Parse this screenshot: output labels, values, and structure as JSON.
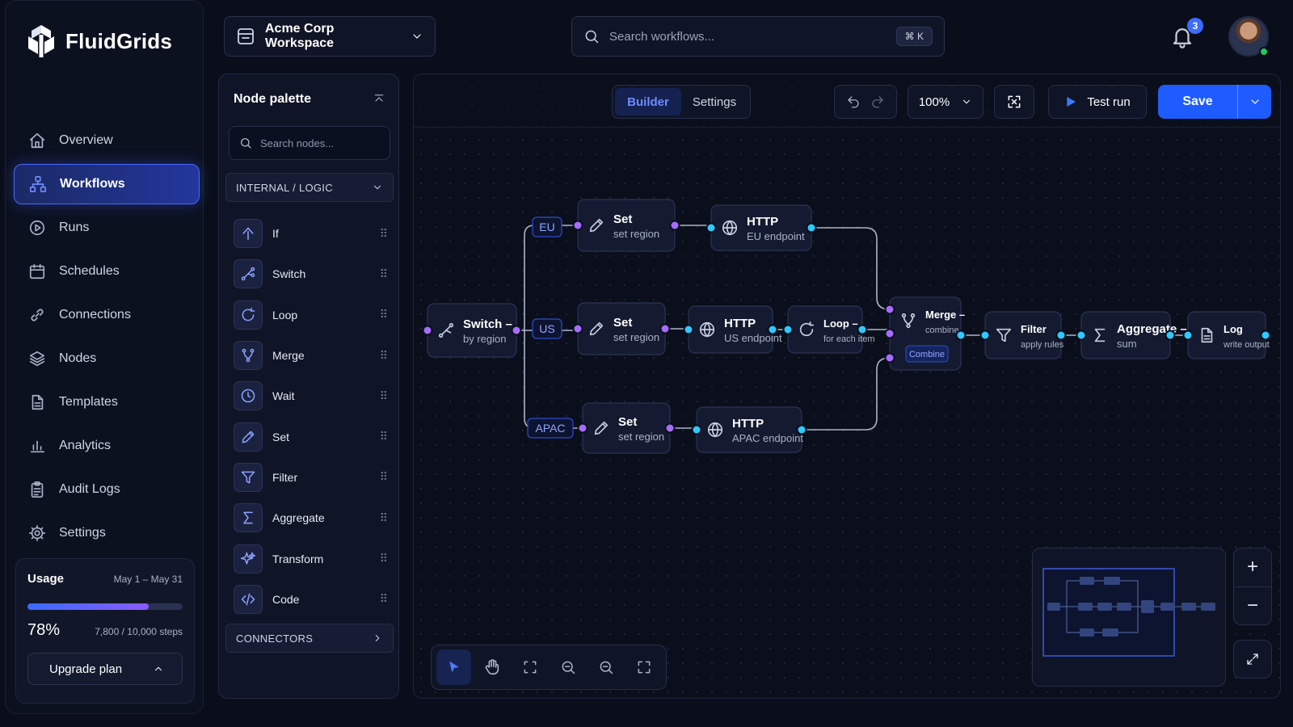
{
  "app": {
    "name": "FluidGrids"
  },
  "sidebar": {
    "items": [
      {
        "label": "Overview",
        "icon": "home-icon"
      },
      {
        "label": "Workflows",
        "icon": "workflow-icon",
        "active": true
      },
      {
        "label": "Runs",
        "icon": "play-circle-icon"
      },
      {
        "label": "Schedules",
        "icon": "calendar-icon"
      },
      {
        "label": "Connections",
        "icon": "link-icon"
      },
      {
        "label": "Nodes",
        "icon": "layers-icon"
      },
      {
        "label": "Templates",
        "icon": "document-icon"
      },
      {
        "label": "Analytics",
        "icon": "bar-chart-icon"
      },
      {
        "label": "Audit Logs",
        "icon": "clipboard-icon"
      },
      {
        "label": "Settings",
        "icon": "gear-icon"
      }
    ],
    "usage": {
      "title": "Usage",
      "range": "May 1 – May 31",
      "percent_label": "78%",
      "percent_value": 0.78,
      "steps": "7,800 / 10,000 steps",
      "upgrade_label": "Upgrade plan"
    }
  },
  "topbar": {
    "workspace": "Acme Corp Workspace",
    "search_placeholder": "Search workflows...",
    "search_shortcut": "⌘ K",
    "notifications": "3"
  },
  "palette": {
    "title": "Node palette",
    "search_placeholder": "Search nodes...",
    "section_internal": "INTERNAL / LOGIC",
    "section_connectors": "CONNECTORS",
    "items": [
      {
        "label": "If",
        "icon": "if-icon"
      },
      {
        "label": "Switch",
        "icon": "switch-icon"
      },
      {
        "label": "Loop",
        "icon": "loop-icon"
      },
      {
        "label": "Merge",
        "icon": "merge-icon"
      },
      {
        "label": "Wait",
        "icon": "clock-icon"
      },
      {
        "label": "Set",
        "icon": "pencil-icon"
      },
      {
        "label": "Filter",
        "icon": "filter-icon"
      },
      {
        "label": "Aggregate",
        "icon": "sigma-icon"
      },
      {
        "label": "Transform",
        "icon": "sparkle-icon"
      },
      {
        "label": "Code",
        "icon": "code-icon"
      }
    ]
  },
  "canvas": {
    "tabs": [
      "Builder",
      "Settings"
    ],
    "active_tab": "Builder",
    "zoom": "100%",
    "test_run": "Test run",
    "save": "Save",
    "nodes": [
      {
        "id": "switch",
        "title": "Switch –",
        "subtitle": "by region",
        "icon": "switch-icon"
      },
      {
        "id": "set_eu",
        "title": "Set",
        "subtitle": "set region",
        "icon": "pencil-icon"
      },
      {
        "id": "http_eu",
        "title": "HTTP",
        "subtitle": "EU endpoint",
        "icon": "globe-icon"
      },
      {
        "id": "set_us",
        "title": "Set",
        "subtitle": "set region",
        "icon": "pencil-icon"
      },
      {
        "id": "http_us",
        "title": "HTTP",
        "subtitle": "US endpoint",
        "icon": "globe-icon"
      },
      {
        "id": "loop",
        "title": "Loop –",
        "subtitle": "for each item",
        "icon": "loop-icon"
      },
      {
        "id": "set_apac",
        "title": "Set",
        "subtitle": "set region",
        "icon": "pencil-icon"
      },
      {
        "id": "http_apac",
        "title": "HTTP",
        "subtitle": "APAC endpoint",
        "icon": "globe-icon"
      },
      {
        "id": "merge",
        "title": "Merge –",
        "subtitle": "combine",
        "tag": "Combine",
        "icon": "merge-icon"
      },
      {
        "id": "filter",
        "title": "Filter",
        "subtitle": "apply rules",
        "icon": "filter-icon"
      },
      {
        "id": "aggregate",
        "title": "Aggregate –",
        "subtitle": "sum",
        "icon": "sigma-icon"
      },
      {
        "id": "log",
        "title": "Log",
        "subtitle": "write output",
        "icon": "document-icon"
      }
    ],
    "branch_labels": [
      "EU",
      "US",
      "APAC"
    ],
    "colors": {
      "accent": "#1f5cff",
      "port_in": "#a66bff",
      "port_out": "#2ec9ff",
      "edge": "#c9d1e6"
    }
  }
}
